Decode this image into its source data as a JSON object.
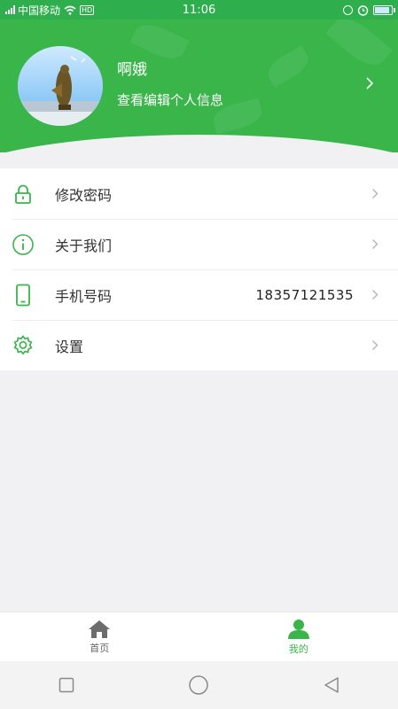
{
  "status_bar": {
    "carrier": "中国移动",
    "hd": "HD",
    "time": "11:06"
  },
  "profile": {
    "name": "啊娥",
    "subtitle": "查看编辑个人信息"
  },
  "menu": [
    {
      "label": "修改密码",
      "icon": "lock-icon"
    },
    {
      "label": "关于我们",
      "icon": "info-icon"
    },
    {
      "label": "手机号码",
      "icon": "phone-icon",
      "value": "18357121535"
    },
    {
      "label": "设置",
      "icon": "gear-icon"
    }
  ],
  "tabs": [
    {
      "label": "首页",
      "icon": "home-icon",
      "active": false
    },
    {
      "label": "我的",
      "icon": "user-icon",
      "active": true
    }
  ],
  "colors": {
    "brand_green": "#39b54a",
    "status_green": "#2fae4d",
    "background": "#f1f1f3"
  }
}
